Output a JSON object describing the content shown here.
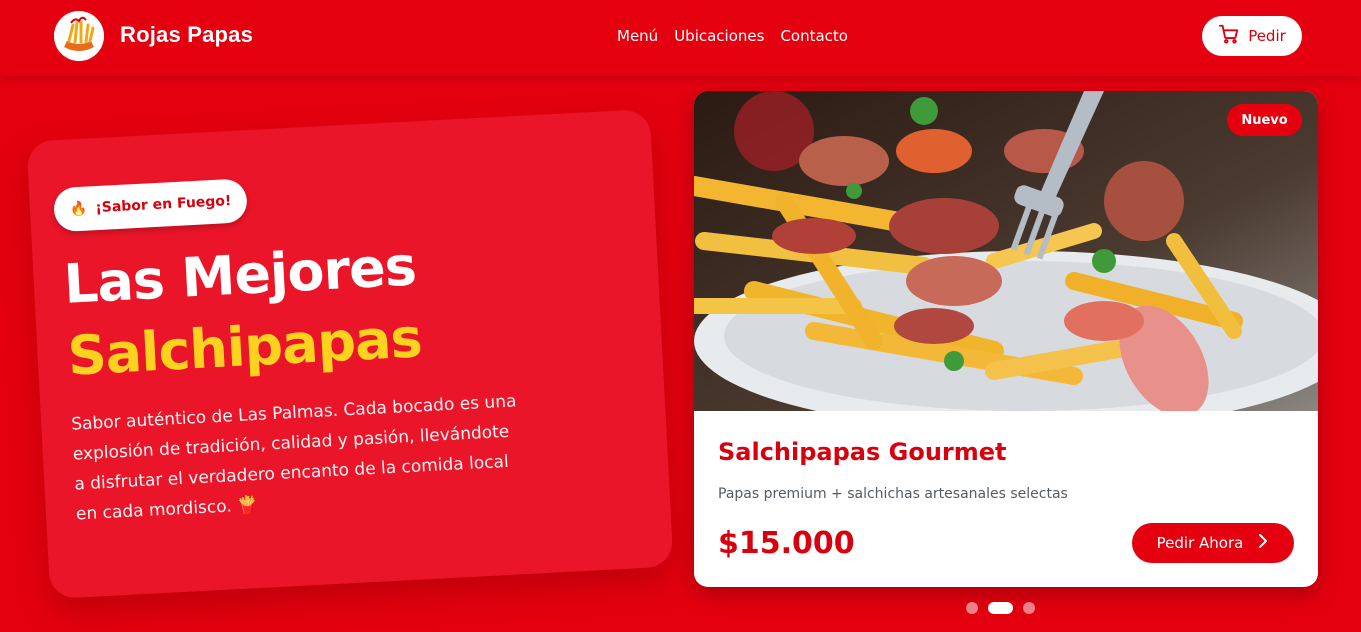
{
  "header": {
    "brand": "Rojas Papas",
    "nav": [
      "Menú",
      "Ubicaciones",
      "Contacto"
    ],
    "order_label": "Pedir"
  },
  "hero": {
    "badge": "¡Sabor en Fuego!",
    "title_line1": "Las Mejores",
    "title_line2": "Salchipapas",
    "description": "Sabor auténtico de Las Palmas. Cada bocado es una explosión de tradición, calidad y pasión, llevándote a disfrutar el verdadero encanto de la comida local en cada mordisco. 🍟"
  },
  "product": {
    "badge": "Nuevo",
    "name": "Salchipapas Gourmet",
    "description": "Papas premium + salchichas artesanales selectas",
    "price": "$15.000",
    "cta": "Pedir Ahora"
  },
  "carousel": {
    "count": 3,
    "active_index": 1
  },
  "colors": {
    "primary": "#e4000f",
    "accent_yellow": "#ffd21f",
    "card_red": "#ea1529"
  }
}
